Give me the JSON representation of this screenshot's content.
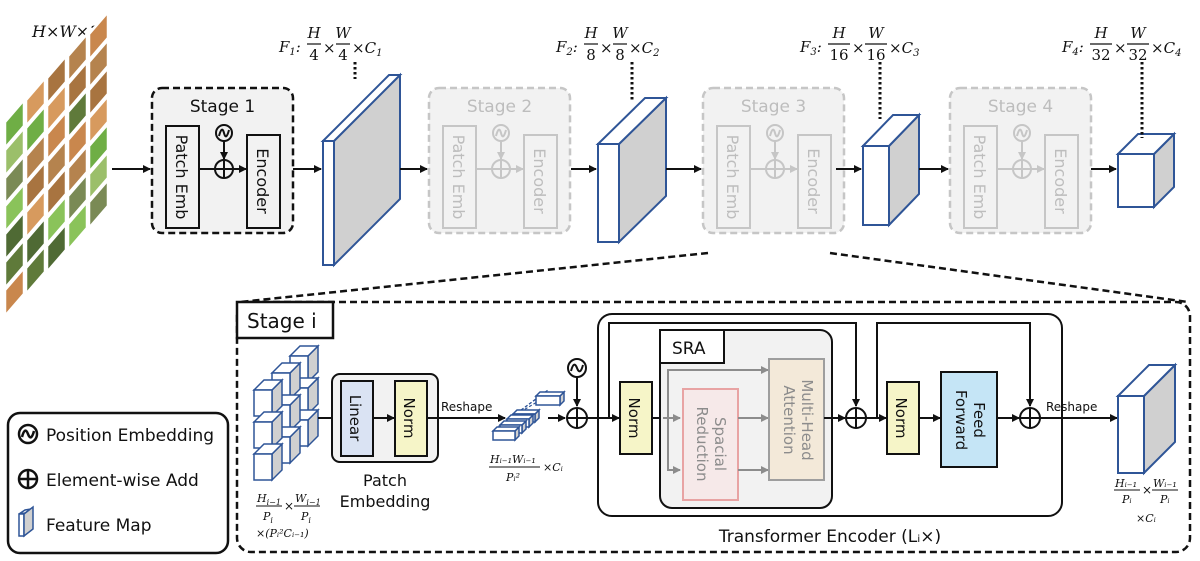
{
  "input": {
    "label": "H×W×3"
  },
  "stages_top": [
    {
      "title": "Stage 1",
      "active": true,
      "patch_label": "Patch Emb",
      "encoder_label": "Encoder"
    },
    {
      "title": "Stage 2",
      "active": false,
      "patch_label": "Patch Emb",
      "encoder_label": "Encoder"
    },
    {
      "title": "Stage 3",
      "active": false,
      "patch_label": "Patch Emb",
      "encoder_label": "Encoder"
    },
    {
      "title": "Stage 4",
      "active": false,
      "patch_label": "Patch Emb",
      "encoder_label": "Encoder"
    }
  ],
  "feature_maps": [
    {
      "name": "F",
      "sub": "1",
      "den": "4",
      "chan": "C",
      "chan_sub": "1"
    },
    {
      "name": "F",
      "sub": "2",
      "den": "8",
      "chan": "C",
      "chan_sub": "2"
    },
    {
      "name": "F",
      "sub": "3",
      "den": "16",
      "chan": "C",
      "chan_sub": "3"
    },
    {
      "name": "F",
      "sub": "4",
      "den": "32",
      "chan": "C",
      "chan_sub": "4"
    }
  ],
  "stage_i": {
    "title": "Stage i",
    "patch_embedding": {
      "caption_line1": "Patch",
      "caption_line2": "Embedding",
      "linear": "Linear",
      "norm": "Norm"
    },
    "input_dims": {
      "line1_num_a": "H",
      "line1_num_a_sub": "i−1",
      "den": "P",
      "den_sub": "i",
      "line1_num_b": "W",
      "line1_num_b_sub": "i−1",
      "line2": "×(Pᵢ²Cᵢ₋₁)"
    },
    "reshape_1": "Reshape",
    "token_dims": {
      "num": "Hᵢ₋₁Wᵢ₋₁",
      "den": "Pᵢ²",
      "suffix": "×Cᵢ"
    },
    "encoder": {
      "norm1": "Norm",
      "sra_title": "SRA",
      "spatial_reduction_line1": "Spacial",
      "spatial_reduction_line2": "Reduction",
      "mha_line1": "Multi-Head",
      "mha_line2": "Attention",
      "norm2": "Norm",
      "ff_line1": "Feed",
      "ff_line2": "Forward",
      "caption": "Transformer Encoder (Lᵢ×)"
    },
    "reshape_2": "Reshape",
    "output_dims": {
      "num_a": "Hᵢ₋₁",
      "num_b": "Wᵢ₋₁",
      "den": "Pᵢ",
      "line2": "×Cᵢ"
    }
  },
  "legend": {
    "items": [
      {
        "icon": "position-embedding-icon",
        "label": "Position Embedding"
      },
      {
        "icon": "element-wise-add-icon",
        "label": "Element-wise Add"
      },
      {
        "icon": "feature-map-icon",
        "label": "Feature Map"
      }
    ]
  },
  "colors": {
    "feature_map_stroke": "#2f5597",
    "feature_map_side": "#d0d0d0",
    "linear_fill": "#dae3f3",
    "norm_fill": "#f6f5c8",
    "ff_fill": "#c5e5f6",
    "sr_stroke": "#e8a3a3",
    "sr_fill": "#f6e9e9",
    "mha_fill": "#f3e9d9",
    "stage_fill": "#f2f2f2",
    "dim_stroke": "#c6c6c6"
  }
}
